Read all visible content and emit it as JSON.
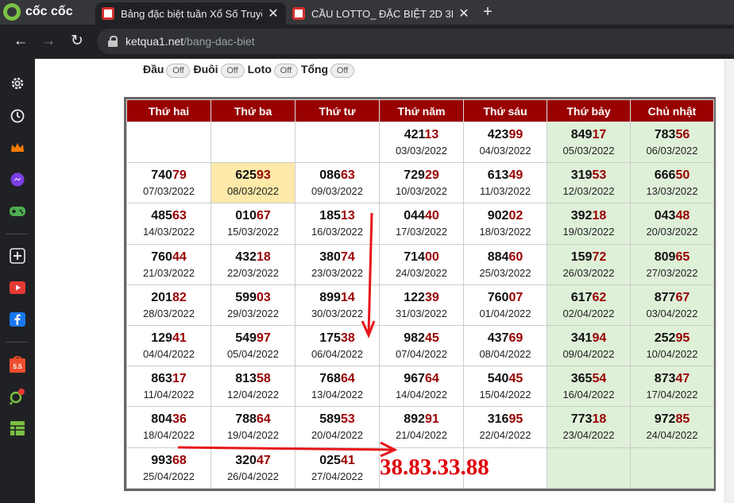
{
  "browser": {
    "brand": "cốc cốc",
    "tabs": [
      {
        "title": "Bảng đặc biệt tuần Xổ Số Truyền Thống",
        "active": true
      },
      {
        "title": "CẦU LOTTO_ ĐẶC BIỆT 2D 3D",
        "active": false
      }
    ],
    "url_host": "ketqua1.net",
    "url_path": "/bang-dac-biet",
    "sidebar_icons": [
      "settings-icon",
      "history-icon",
      "crown-icon",
      "messenger-icon",
      "gamepad-icon",
      "add-icon",
      "youtube-icon",
      "facebook-icon",
      "shopee-icon",
      "map-pin-icon",
      "sheet-icon"
    ]
  },
  "filters": [
    {
      "label": "Đầu",
      "state": "Off"
    },
    {
      "label": "Đuôi",
      "state": "Off"
    },
    {
      "label": "Loto",
      "state": "Off"
    },
    {
      "label": "Tổng",
      "state": "Off"
    }
  ],
  "table": {
    "headers": [
      "Thứ hai",
      "Thứ ba",
      "Thứ tư",
      "Thứ năm",
      "Thứ sáu",
      "Thứ bảy",
      "Chủ nhật"
    ],
    "rows": [
      [
        null,
        null,
        null,
        {
          "head": "421",
          "tail": "13",
          "date": "03/03/2022"
        },
        {
          "head": "423",
          "tail": "99",
          "date": "04/03/2022"
        },
        {
          "head": "849",
          "tail": "17",
          "date": "05/03/2022"
        },
        {
          "head": "783",
          "tail": "56",
          "date": "06/03/2022"
        }
      ],
      [
        {
          "head": "740",
          "tail": "79",
          "date": "07/03/2022"
        },
        {
          "head": "625",
          "tail": "93",
          "date": "08/03/2022",
          "highlight": true
        },
        {
          "head": "086",
          "tail": "63",
          "date": "09/03/2022"
        },
        {
          "head": "729",
          "tail": "29",
          "date": "10/03/2022"
        },
        {
          "head": "613",
          "tail": "49",
          "date": "11/03/2022"
        },
        {
          "head": "319",
          "tail": "53",
          "date": "12/03/2022"
        },
        {
          "head": "666",
          "tail": "50",
          "date": "13/03/2022"
        }
      ],
      [
        {
          "head": "485",
          "tail": "63",
          "date": "14/03/2022"
        },
        {
          "head": "010",
          "tail": "67",
          "date": "15/03/2022"
        },
        {
          "head": "185",
          "tail": "13",
          "date": "16/03/2022"
        },
        {
          "head": "044",
          "tail": "40",
          "date": "17/03/2022"
        },
        {
          "head": "902",
          "tail": "02",
          "date": "18/03/2022"
        },
        {
          "head": "392",
          "tail": "18",
          "date": "19/03/2022"
        },
        {
          "head": "043",
          "tail": "48",
          "date": "20/03/2022"
        }
      ],
      [
        {
          "head": "760",
          "tail": "44",
          "date": "21/03/2022"
        },
        {
          "head": "432",
          "tail": "18",
          "date": "22/03/2022"
        },
        {
          "head": "380",
          "tail": "74",
          "date": "23/03/2022"
        },
        {
          "head": "714",
          "tail": "00",
          "date": "24/03/2022"
        },
        {
          "head": "884",
          "tail": "60",
          "date": "25/03/2022"
        },
        {
          "head": "159",
          "tail": "72",
          "date": "26/03/2022"
        },
        {
          "head": "809",
          "tail": "65",
          "date": "27/03/2022"
        }
      ],
      [
        {
          "head": "201",
          "tail": "82",
          "date": "28/03/2022"
        },
        {
          "head": "599",
          "tail": "03",
          "date": "29/03/2022"
        },
        {
          "head": "899",
          "tail": "14",
          "date": "30/03/2022"
        },
        {
          "head": "122",
          "tail": "39",
          "date": "31/03/2022"
        },
        {
          "head": "760",
          "tail": "07",
          "date": "01/04/2022"
        },
        {
          "head": "617",
          "tail": "62",
          "date": "02/04/2022"
        },
        {
          "head": "877",
          "tail": "67",
          "date": "03/04/2022"
        }
      ],
      [
        {
          "head": "129",
          "tail": "41",
          "date": "04/04/2022"
        },
        {
          "head": "549",
          "tail": "97",
          "date": "05/04/2022"
        },
        {
          "head": "175",
          "tail": "38",
          "date": "06/04/2022"
        },
        {
          "head": "982",
          "tail": "45",
          "date": "07/04/2022"
        },
        {
          "head": "437",
          "tail": "69",
          "date": "08/04/2022"
        },
        {
          "head": "341",
          "tail": "94",
          "date": "09/04/2022"
        },
        {
          "head": "252",
          "tail": "95",
          "date": "10/04/2022"
        }
      ],
      [
        {
          "head": "863",
          "tail": "17",
          "date": "11/04/2022"
        },
        {
          "head": "813",
          "tail": "58",
          "date": "12/04/2022"
        },
        {
          "head": "768",
          "tail": "64",
          "date": "13/04/2022"
        },
        {
          "head": "967",
          "tail": "64",
          "date": "14/04/2022"
        },
        {
          "head": "540",
          "tail": "45",
          "date": "15/04/2022"
        },
        {
          "head": "365",
          "tail": "54",
          "date": "16/04/2022"
        },
        {
          "head": "873",
          "tail": "47",
          "date": "17/04/2022"
        }
      ],
      [
        {
          "head": "804",
          "tail": "36",
          "date": "18/04/2022"
        },
        {
          "head": "788",
          "tail": "64",
          "date": "19/04/2022"
        },
        {
          "head": "589",
          "tail": "53",
          "date": "20/04/2022"
        },
        {
          "head": "892",
          "tail": "91",
          "date": "21/04/2022"
        },
        {
          "head": "316",
          "tail": "95",
          "date": "22/04/2022"
        },
        {
          "head": "773",
          "tail": "18",
          "date": "23/04/2022"
        },
        {
          "head": "972",
          "tail": "85",
          "date": "24/04/2022"
        }
      ],
      [
        {
          "head": "993",
          "tail": "68",
          "date": "25/04/2022"
        },
        {
          "head": "320",
          "tail": "47",
          "date": "26/04/2022"
        },
        {
          "head": "025",
          "tail": "41",
          "date": "27/04/2022"
        },
        {
          "text": "38.83.33.88"
        },
        null,
        null,
        null
      ]
    ]
  },
  "annotation_color": "#e8161a"
}
